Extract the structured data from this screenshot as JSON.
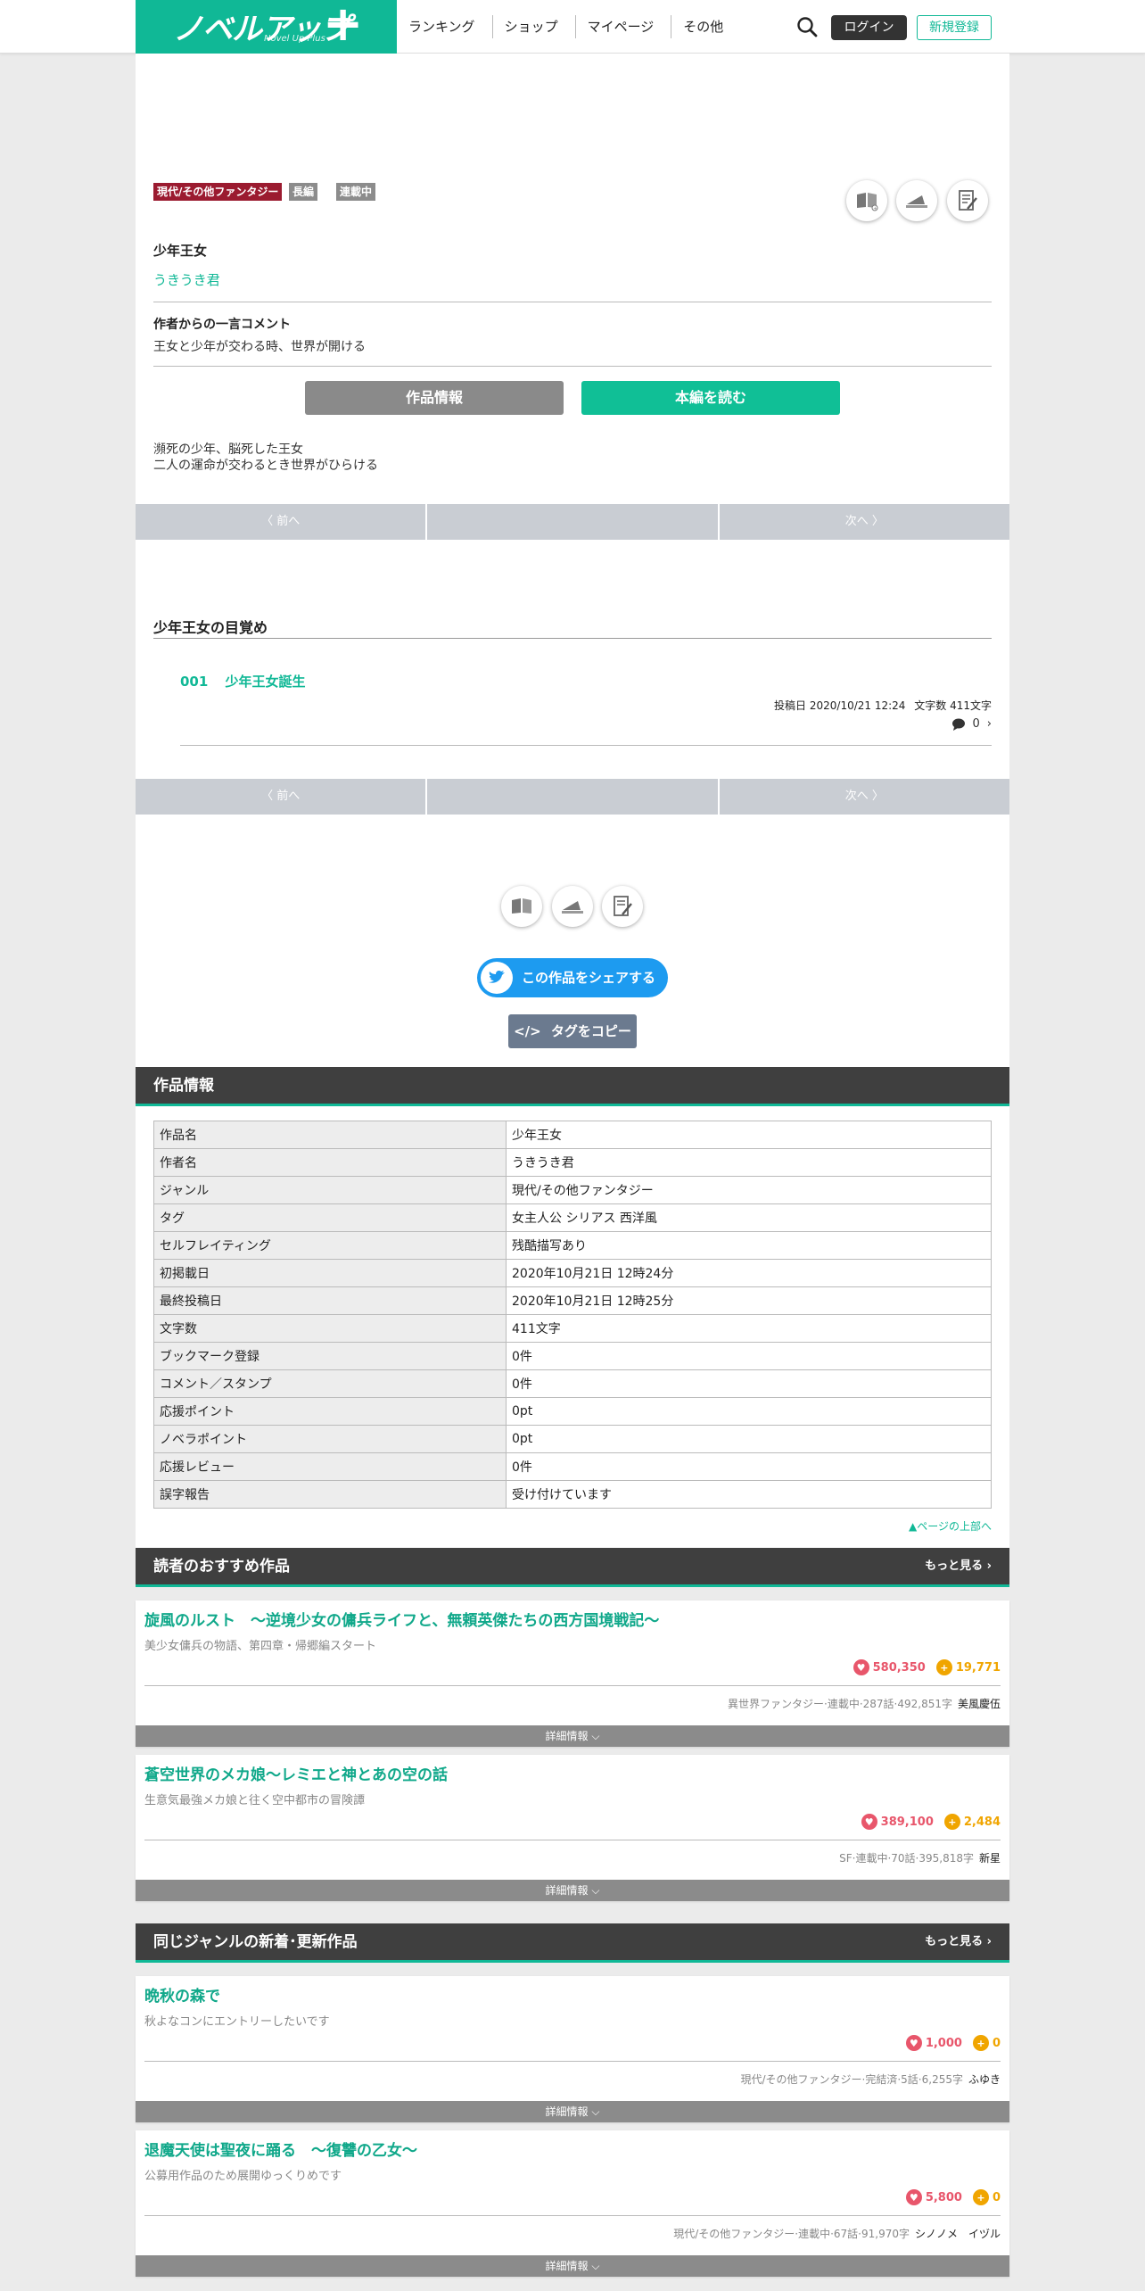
{
  "header": {
    "logo_main": "ノベルアップ",
    "logo_sub": "Novel Up Plus",
    "logo_plus": "+",
    "nav": [
      "ランキング",
      "ショップ",
      "マイページ",
      "その他"
    ],
    "login": "ログイン",
    "register": "新規登録"
  },
  "work": {
    "tags": [
      "現代/その他ファンタジー",
      "長編",
      "連載中"
    ],
    "title_label": "少年王女",
    "author": "うきうき君",
    "comment_label": "作者からの一言コメント",
    "comment": "王女と少年が交わる時、世界が開ける",
    "info_button": "作品情報",
    "read_button": "本編を読む",
    "synopsis_1": "瀕死の少年、脳死した王女",
    "synopsis_2": "二人の運命が交わるとき世界がひらける"
  },
  "pager": {
    "prev": "前へ",
    "next": "次へ"
  },
  "chapter": {
    "title": "少年王女の目覚め",
    "episode_no": "001",
    "episode_title": "少年王女誕生",
    "posted": "投稿日 2020/10/21 12:24",
    "chars": "文字数 411文字",
    "comments": "0"
  },
  "share": {
    "twitter": "この作品をシェアする",
    "copy_tag": "タグをコピー"
  },
  "info_section": {
    "title": "作品情報",
    "rows": [
      {
        "k": "作品名",
        "v": "少年王女",
        "link": false
      },
      {
        "k": "作者名",
        "v": "うきうき君",
        "link": true
      },
      {
        "k": "ジャンル",
        "v": "現代/その他ファンタジー",
        "link": true
      },
      {
        "k": "タグ",
        "v": "女主人公 シリアス 西洋風",
        "link": true
      },
      {
        "k": "セルフレイティング",
        "v": "残酷描写あり",
        "link": false
      },
      {
        "k": "初掲載日",
        "v": "2020年10月21日 12時24分",
        "link": false
      },
      {
        "k": "最終投稿日",
        "v": "2020年10月21日 12時25分",
        "link": false
      },
      {
        "k": "文字数",
        "v": "411文字",
        "link": false
      },
      {
        "k": "ブックマーク登録",
        "v": "0件",
        "link": false
      },
      {
        "k": "コメント／スタンプ",
        "v": "0件",
        "link": false
      },
      {
        "k": "応援ポイント",
        "v": "0pt",
        "link": false
      },
      {
        "k": "ノベラポイント",
        "v": "0pt",
        "link": false
      },
      {
        "k": "応援レビュー",
        "v": "0件",
        "link": false
      },
      {
        "k": "誤字報告",
        "v": "受け付けています",
        "link": false
      }
    ],
    "page_top": "▲ページの上部へ"
  },
  "recommend": {
    "title": "読者のおすすめ作品",
    "more": "もっと見る",
    "cards": [
      {
        "title": "旋風のルスト　～逆境少女の傭兵ライフと、無頼英傑たちの西方国境戦記～",
        "sub": "美少女傭兵の物語、第四章・帰郷編スタート",
        "points": "580,350",
        "novela": "19,771",
        "meta": "異世界ファンタジー·連載中·287話·492,851字",
        "author": "美風慶伍",
        "detail": "詳細情報"
      },
      {
        "title": "蒼空世界のメカ娘～レミエと神とあの空の話",
        "sub": "生意気最強メカ娘と往く空中都市の冒険譚",
        "points": "389,100",
        "novela": "2,484",
        "meta": "SF·連載中·70話·395,818字",
        "author": "新星",
        "detail": "詳細情報"
      }
    ]
  },
  "genre": {
    "title": "同じジャンルの新着･更新作品",
    "more": "もっと見る",
    "cards": [
      {
        "title": "晩秋の森で",
        "sub": "秋よなコンにエントリーしたいです",
        "points": "1,000",
        "novela": "0",
        "meta": "現代/その他ファンタジー·完結済·5話·6,255字",
        "author": "ふゆき",
        "detail": "詳細情報"
      },
      {
        "title": "退魔天使は聖夜に踊る　～復讐の乙女～",
        "sub": "公募用作品のため展開ゆっくりめです",
        "points": "5,800",
        "novela": "0",
        "meta": "現代/その他ファンタジー·連載中·67話·91,970字",
        "author": "シノノメ　イヅル",
        "detail": "詳細情報"
      }
    ]
  },
  "colors": {
    "accent": "#10b896",
    "genre_tag": "#9b1b30",
    "heart": "#e8566b",
    "coin": "#f0a500"
  },
  "icons": [
    "search-icon",
    "bookmark-icon",
    "megaphone-icon",
    "review-icon",
    "twitter-icon",
    "code-icon",
    "chevron-right-icon",
    "chevron-left-icon",
    "chevron-down-icon",
    "comment-icon",
    "heart-icon",
    "coin-icon"
  ]
}
